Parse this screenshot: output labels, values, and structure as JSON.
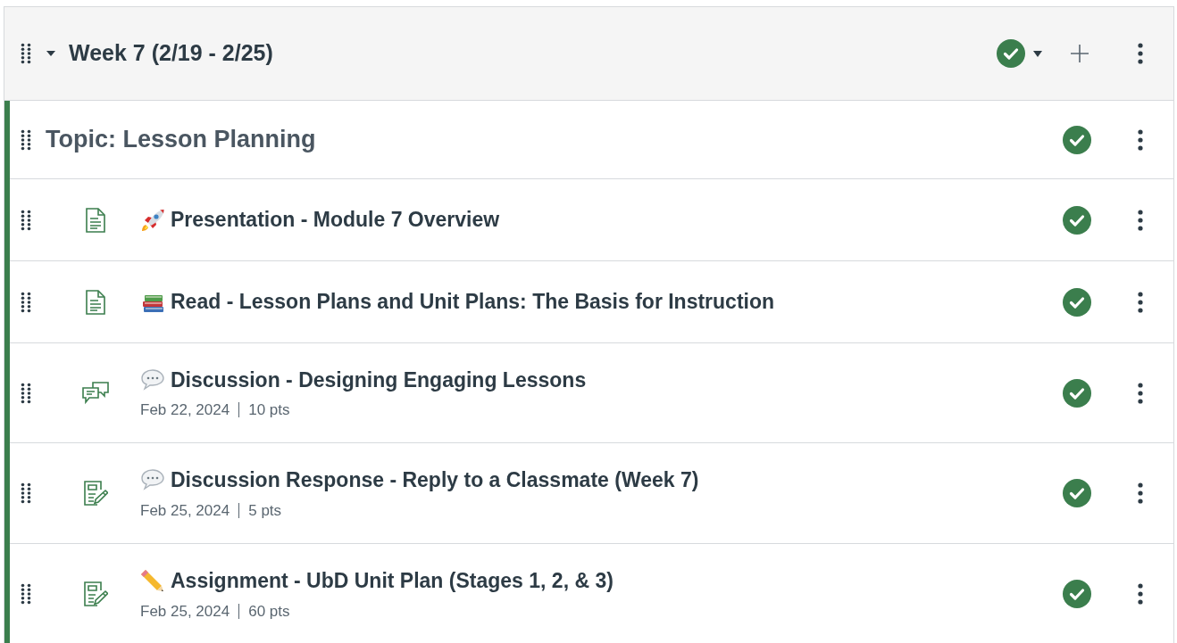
{
  "module": {
    "title": "Week 7 (2/19 - 2/25)",
    "expanded": true,
    "published": true
  },
  "items": [
    {
      "kind": "header",
      "title": "Topic: Lesson Planning",
      "published": true
    },
    {
      "kind": "page",
      "badge": {
        "kind": "rocket"
      },
      "title": "Presentation - Module 7 Overview",
      "published": true
    },
    {
      "kind": "page",
      "badge": {
        "kind": "books"
      },
      "title": "Read - Lesson Plans and Unit Plans: The Basis for Instruction",
      "published": true
    },
    {
      "kind": "discussion",
      "badge": {
        "kind": "speech"
      },
      "title": "Discussion - Designing Engaging Lessons",
      "date": "Feb 22, 2024",
      "points": "10 pts",
      "published": true
    },
    {
      "kind": "assignment",
      "badge": {
        "kind": "speech"
      },
      "title": "Discussion Response - Reply to a Classmate (Week 7)",
      "date": "Feb 25, 2024",
      "points": "5 pts",
      "published": true
    },
    {
      "kind": "assignment",
      "badge": {
        "kind": "pencil"
      },
      "title": "Assignment - UbD Unit Plan (Stages 1, 2, & 3)",
      "date": "Feb 25, 2024",
      "points": "60 pts",
      "published": true
    }
  ]
}
